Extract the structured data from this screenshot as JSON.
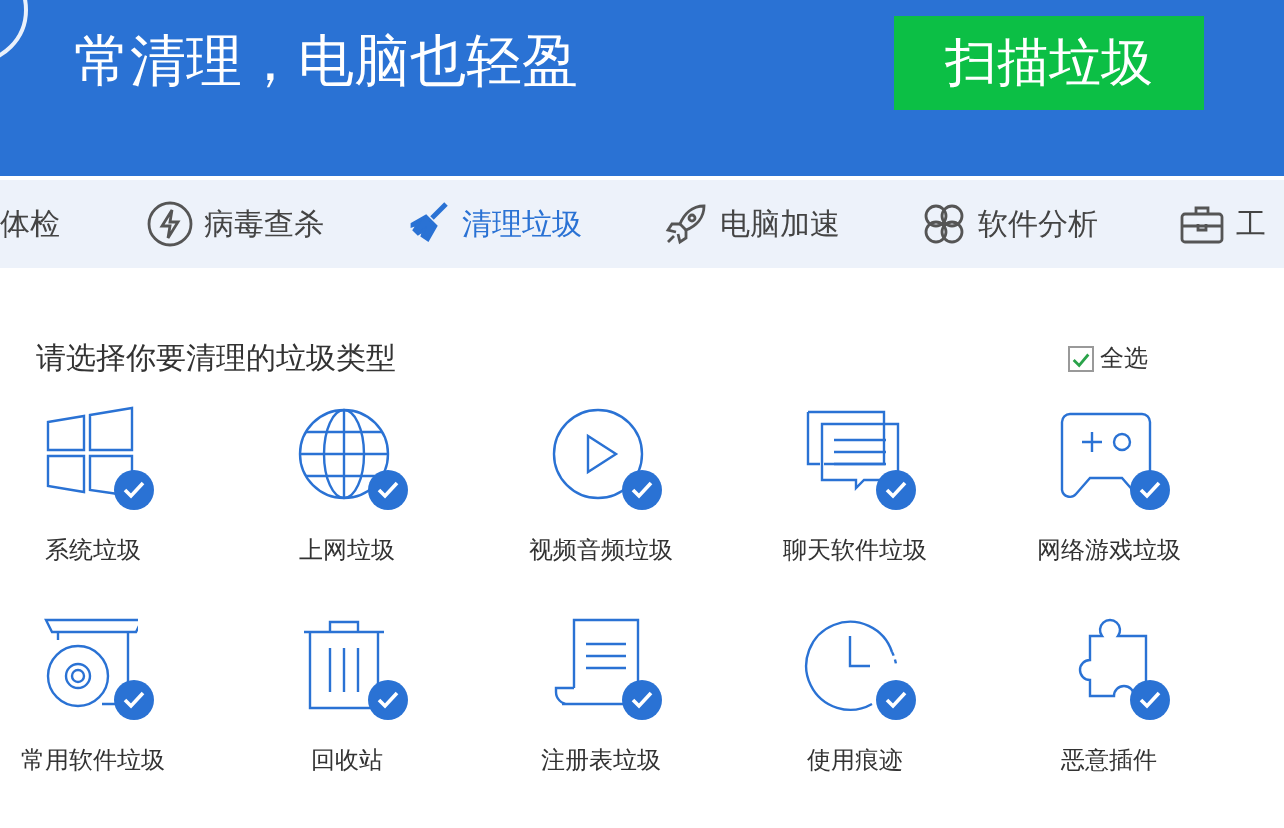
{
  "header": {
    "title": "常清理，电脑也轻盈",
    "scan_button": "扫描垃圾"
  },
  "tabs": [
    {
      "label": "体检",
      "selected": false
    },
    {
      "label": "病毒查杀",
      "selected": false
    },
    {
      "label": "清理垃圾",
      "selected": true
    },
    {
      "label": "电脑加速",
      "selected": false
    },
    {
      "label": "软件分析",
      "selected": false
    },
    {
      "label": "工",
      "selected": false
    }
  ],
  "content": {
    "heading": "请选择你要清理的垃圾类型",
    "select_all": {
      "label": "全选",
      "checked": true
    },
    "items": [
      {
        "label": "系统垃圾",
        "checked": true
      },
      {
        "label": "上网垃圾",
        "checked": true
      },
      {
        "label": "视频音频垃圾",
        "checked": true
      },
      {
        "label": "聊天软件垃圾",
        "checked": true
      },
      {
        "label": "网络游戏垃圾",
        "checked": true
      },
      {
        "label": "常用软件垃圾",
        "checked": true
      },
      {
        "label": "回收站",
        "checked": true
      },
      {
        "label": "注册表垃圾",
        "checked": true
      },
      {
        "label": "使用痕迹",
        "checked": true
      },
      {
        "label": "恶意插件",
        "checked": true
      }
    ]
  }
}
